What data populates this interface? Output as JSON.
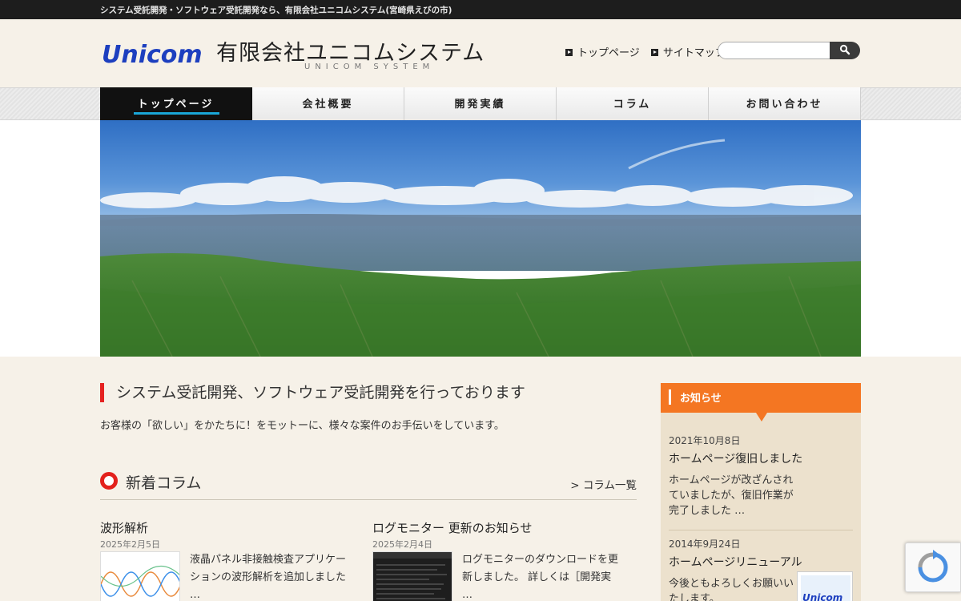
{
  "topbar": {
    "text": "システム受託開発・ソフトウェア受託開発なら、有限会社ユニコムシステム(宮崎県えびの市)"
  },
  "header": {
    "logo_text": "Unicom",
    "company_jp": "有限会社ユニコムシステム",
    "company_en": "UNICOM SYSTEM",
    "links": [
      {
        "label": "トップページ"
      },
      {
        "label": "サイトマップ"
      }
    ],
    "search": {
      "value": "",
      "icon": "search-icon"
    }
  },
  "nav": {
    "items": [
      {
        "label": "トップページ",
        "active": true
      },
      {
        "label": "会社概要",
        "active": false
      },
      {
        "label": "開発実績",
        "active": false
      },
      {
        "label": "コラム",
        "active": false
      },
      {
        "label": "お問い合わせ",
        "active": false
      }
    ]
  },
  "main": {
    "title": "システム受託開発、ソフトウェア受託開発を行っております",
    "description": "お客様の「欲しい」をかたちに！をモットーに、様々な案件のお手伝いをしています。"
  },
  "columns": {
    "heading": "新着コラム",
    "more_link": "> コラム一覧",
    "posts": [
      {
        "title": "波形解析",
        "date": "2025年2月5日",
        "excerpt": "液晶パネル非接触検査アプリケーションの波形解析を追加しました …"
      },
      {
        "title": "ログモニター 更新のお知らせ",
        "date": "2025年2月4日",
        "excerpt": "ログモニターのダウンロードを更新しました。 詳しくは［開発実 …"
      }
    ]
  },
  "sidebar": {
    "heading": "お知らせ",
    "news": [
      {
        "date": "2021年10月8日",
        "title": "ホームページ復旧しました",
        "body": "ホームページが改ざんされていましたが、復旧作業が完了しました …"
      },
      {
        "date": "2014年9月24日",
        "title": "ホームページリニューアル",
        "body": "今後ともよろしくお願いいたします。"
      }
    ]
  },
  "colors": {
    "accent_red": "#e52220",
    "nav_active": "#111111",
    "nav_underline": "#1aa7d8",
    "sidebar_orange": "#f47622",
    "logo_blue": "#1d3fbf"
  }
}
